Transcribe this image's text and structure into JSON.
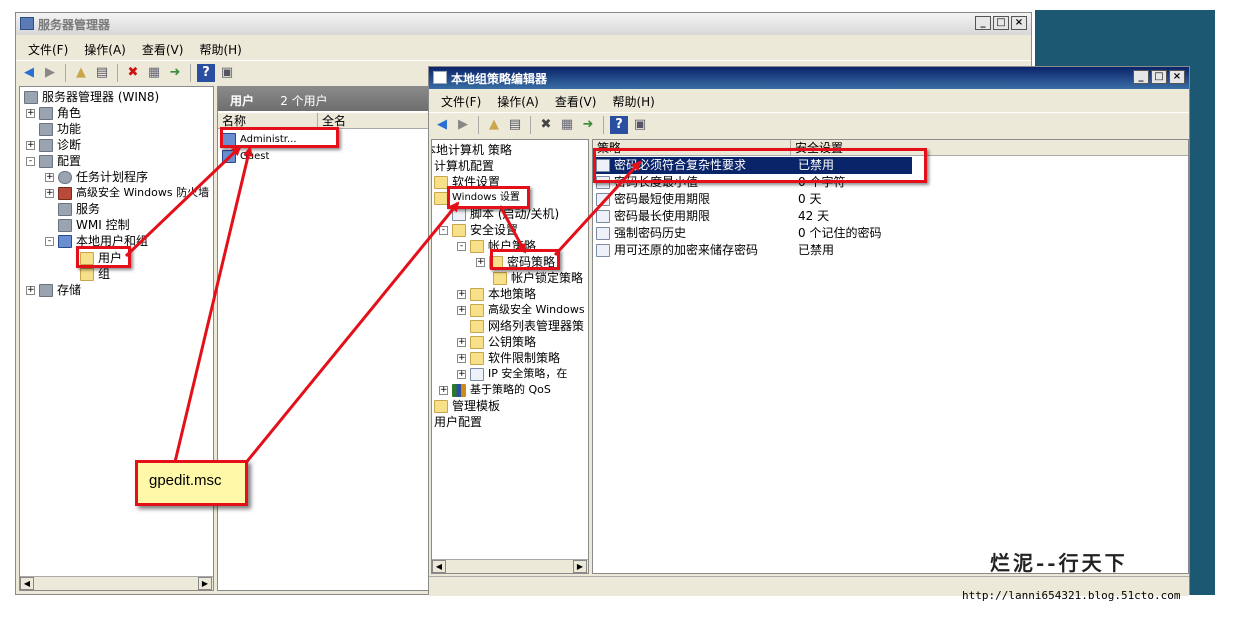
{
  "server_manager": {
    "title": "服务器管理器",
    "menu": [
      "文件(F)",
      "操作(A)",
      "查看(V)",
      "帮助(H)"
    ],
    "tree": [
      {
        "label": "服务器管理器 (WIN8)",
        "level": 0,
        "expander": ""
      },
      {
        "label": "角色",
        "level": 1,
        "expander": "+"
      },
      {
        "label": "功能",
        "level": 1,
        "expander": ""
      },
      {
        "label": "诊断",
        "level": 1,
        "expander": "+"
      },
      {
        "label": "配置",
        "level": 1,
        "expander": "-"
      },
      {
        "label": "任务计划程序",
        "level": 2,
        "expander": "+"
      },
      {
        "label": "高级安全 Windows 防火墙",
        "level": 2,
        "expander": "+"
      },
      {
        "label": "服务",
        "level": 2,
        "expander": ""
      },
      {
        "label": "WMI 控制",
        "level": 2,
        "expander": ""
      },
      {
        "label": "本地用户和组",
        "level": 2,
        "expander": "-"
      },
      {
        "label": "用户",
        "level": 3,
        "expander": ""
      },
      {
        "label": "组",
        "level": 3,
        "expander": ""
      },
      {
        "label": "存储",
        "level": 1,
        "expander": "+"
      }
    ],
    "list_header": {
      "title": "用户",
      "count": "2 个用户"
    },
    "columns": [
      "名称",
      "全名"
    ],
    "users": [
      "Administr...",
      "Guest"
    ]
  },
  "gpedit": {
    "title": "本地组策略编辑器",
    "menu": [
      "文件(F)",
      "操作(A)",
      "查看(V)",
      "帮助(H)"
    ],
    "tree": [
      {
        "label": "本地计算机 策略",
        "level": 0,
        "expander": ""
      },
      {
        "label": "计算机配置",
        "level": 0,
        "expander": ""
      },
      {
        "label": "软件设置",
        "level": 1,
        "expander": ""
      },
      {
        "label": "Windows 设置",
        "level": 1,
        "expander": ""
      },
      {
        "label": "脚本 (启动/关机)",
        "level": 2,
        "expander": ""
      },
      {
        "label": "安全设置",
        "level": 2,
        "expander": "-"
      },
      {
        "label": "帐户策略",
        "level": 3,
        "expander": "-"
      },
      {
        "label": "密码策略",
        "level": 4,
        "expander": "+"
      },
      {
        "label": "帐户锁定策略",
        "level": 4,
        "expander": ""
      },
      {
        "label": "本地策略",
        "level": 3,
        "expander": "+"
      },
      {
        "label": "高级安全 Windows",
        "level": 3,
        "expander": "+"
      },
      {
        "label": "网络列表管理器策",
        "level": 3,
        "expander": ""
      },
      {
        "label": "公钥策略",
        "level": 3,
        "expander": "+"
      },
      {
        "label": "软件限制策略",
        "level": 3,
        "expander": "+"
      },
      {
        "label": "IP 安全策略，在",
        "level": 3,
        "expander": "+"
      },
      {
        "label": "基于策略的 QoS",
        "level": 2,
        "expander": "+"
      },
      {
        "label": "管理模板",
        "level": 1,
        "expander": ""
      },
      {
        "label": "用户配置",
        "level": 0,
        "expander": ""
      }
    ],
    "columns": [
      "策略",
      "安全设置"
    ],
    "policies": [
      {
        "name": "密码必须符合复杂性要求",
        "value": "已禁用"
      },
      {
        "name": "密码长度最小值",
        "value": "0 个字符"
      },
      {
        "name": "密码最短使用期限",
        "value": "0 天"
      },
      {
        "name": "密码最长使用期限",
        "value": "42 天"
      },
      {
        "name": "强制密码历史",
        "value": "0 个记住的密码"
      },
      {
        "name": "用可还原的加密来储存密码",
        "value": "已禁用"
      }
    ]
  },
  "callout": "gpedit.msc",
  "watermark": {
    "title": "烂泥--行天下",
    "url": "http://lanni654321.blog.51cto.com"
  },
  "colors": {
    "annotation": "#e3101a",
    "selection": "#0a246a",
    "callout_bg": "#fff8a8"
  }
}
